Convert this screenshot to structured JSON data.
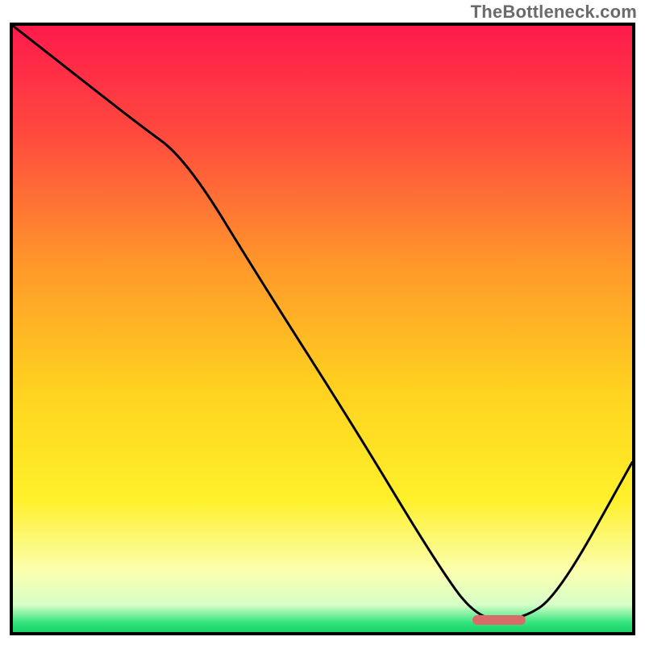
{
  "attribution": "TheBottleneck.com",
  "chart_data": {
    "type": "line",
    "title": "",
    "xlabel": "",
    "ylabel": "",
    "xlim": [
      0,
      100
    ],
    "ylim": [
      0,
      100
    ],
    "series": [
      {
        "name": "bottleneck-curve",
        "x": [
          0,
          10,
          20,
          28,
          40,
          55,
          68,
          75,
          82,
          88,
          100
        ],
        "y": [
          100,
          92,
          84,
          78,
          58,
          34,
          12,
          2,
          2,
          6,
          28
        ]
      }
    ],
    "marker": {
      "name": "optimal-range",
      "x_start": 75,
      "x_end": 82,
      "y": 2,
      "color": "#d86a6a",
      "thickness": 12
    },
    "background_gradient": {
      "stops": [
        {
          "offset": 0.0,
          "color": "#ff1a4b"
        },
        {
          "offset": 0.18,
          "color": "#ff4a3e"
        },
        {
          "offset": 0.4,
          "color": "#ff9a2a"
        },
        {
          "offset": 0.6,
          "color": "#ffd21f"
        },
        {
          "offset": 0.78,
          "color": "#fff02a"
        },
        {
          "offset": 0.9,
          "color": "#fbffb0"
        },
        {
          "offset": 0.955,
          "color": "#d7ffc8"
        },
        {
          "offset": 0.985,
          "color": "#2fe47a"
        },
        {
          "offset": 1.0,
          "color": "#18d268"
        }
      ]
    }
  }
}
